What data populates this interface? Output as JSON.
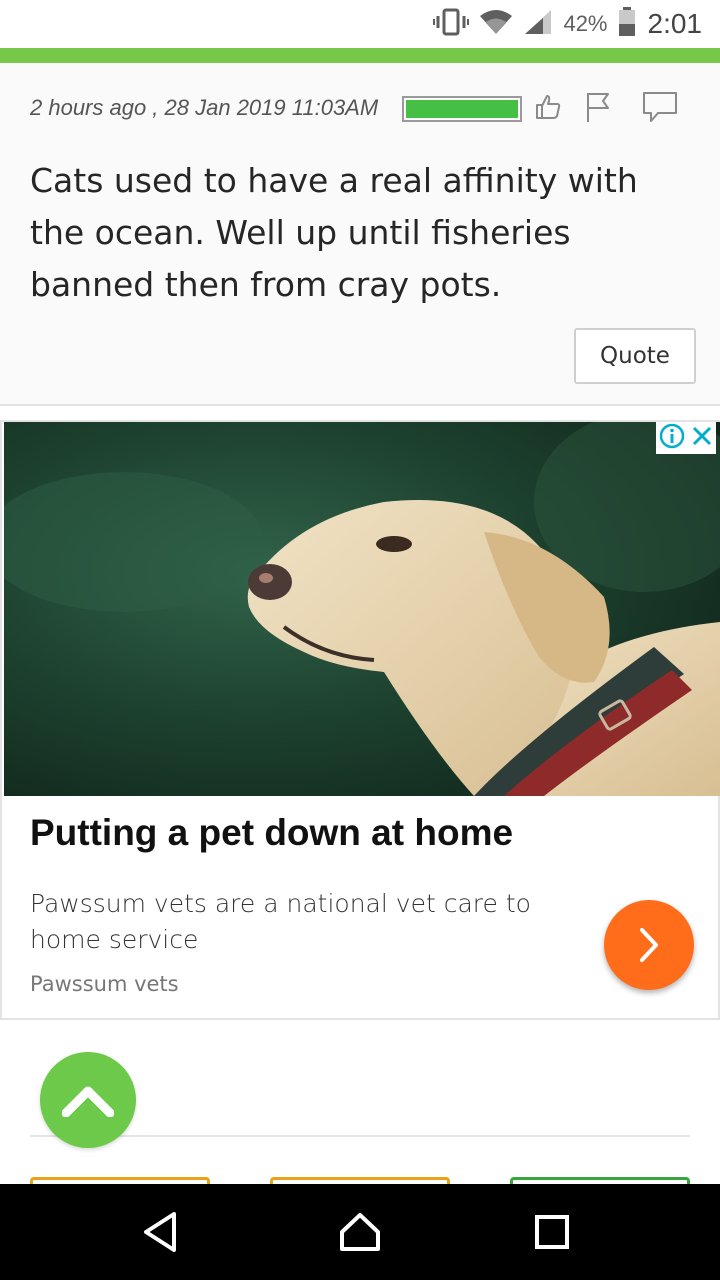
{
  "status_bar": {
    "battery_percent": "42%",
    "time": "2:01"
  },
  "comment": {
    "meta": "2 hours ago , 28 Jan 2019 11:03AM",
    "rating_fraction": 1.0,
    "text": "Cats used to have a real affinity with the ocean. Well up until fisheries banned then from cray pots.",
    "quote_label": "Quote"
  },
  "ad": {
    "title": "Putting a pet down at home",
    "description": "Pawssum vets are a national vet care to home service",
    "source": "Pawssum vets"
  },
  "colors": {
    "accent_green": "#77c84a",
    "rating_green": "#45c045",
    "ad_arrow_orange": "#ff6d1b",
    "scroll_top_green": "#6cc94a",
    "tab_gold": "#e8a317",
    "tab_green": "#3aa53a"
  },
  "icons": {
    "status": [
      "vibrate-icon",
      "wifi-icon",
      "signal-icon",
      "battery-icon"
    ],
    "comment_actions": [
      "thumbs-up-icon",
      "flag-icon",
      "comment-icon"
    ],
    "ad": [
      "info-icon",
      "close-icon",
      "chevron-right-icon"
    ],
    "nav": [
      "back-icon",
      "home-icon",
      "recents-icon"
    ]
  }
}
